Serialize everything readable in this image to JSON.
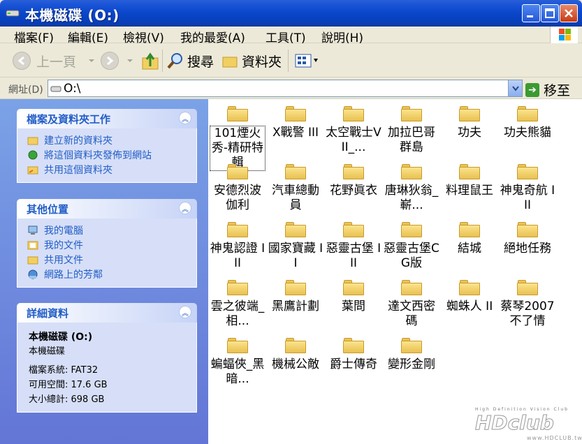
{
  "window": {
    "title": "本機磁碟 (O:)"
  },
  "menu": [
    "檔案(F)",
    "編輯(E)",
    "檢視(V)",
    "我的最愛(A)",
    "工具(T)",
    "說明(H)"
  ],
  "toolbar": {
    "back_label": "上一頁",
    "search_label": "搜尋",
    "folders_label": "資料夾"
  },
  "address": {
    "label": "網址(D)",
    "value": "O:\\",
    "go_label": "移至"
  },
  "tasks_panel": {
    "title": "檔案及資料夾工作",
    "items": [
      "建立新的資料夾",
      "將這個資料夾發佈到網站",
      "共用這個資料夾"
    ]
  },
  "places_panel": {
    "title": "其他位置",
    "items": [
      "我的電腦",
      "我的文件",
      "共用文件",
      "網路上的芳鄰"
    ]
  },
  "details_panel": {
    "title": "詳細資料",
    "name": "本機磁碟 (O:)",
    "type": "本機磁碟",
    "filesystem": "檔案系統: FAT32",
    "free": "可用空間: 17.6 GB",
    "total": "大小總計: 698 GB"
  },
  "folders": [
    "101煙火秀-精研特輯",
    "X戰警 III",
    "太空戰士VII_...",
    "加拉巴哥群島",
    "功夫",
    "功夫熊貓",
    "安德烈波伽利",
    "汽車總動員",
    "花野眞衣",
    "唐琳狄翁_嶄...",
    "料理鼠王",
    "神鬼奇航 III",
    "神鬼認證 III",
    "國家寶藏 II",
    "惡靈古堡 III",
    "惡靈古堡CG版",
    "結城",
    "絕地任務",
    "雲之彼端_相...",
    "黑鷹計劃",
    "葉問",
    "達文西密碼",
    "蜘蛛人 II",
    "蔡琴2007不了情",
    "蝙蝠俠_黑暗...",
    "機械公敵",
    "爵士傳奇",
    "變形金剛"
  ],
  "watermark": {
    "top": "High Definition Vision Club",
    "main": "HDclub",
    "url": "www.HDCLUB.tw"
  }
}
